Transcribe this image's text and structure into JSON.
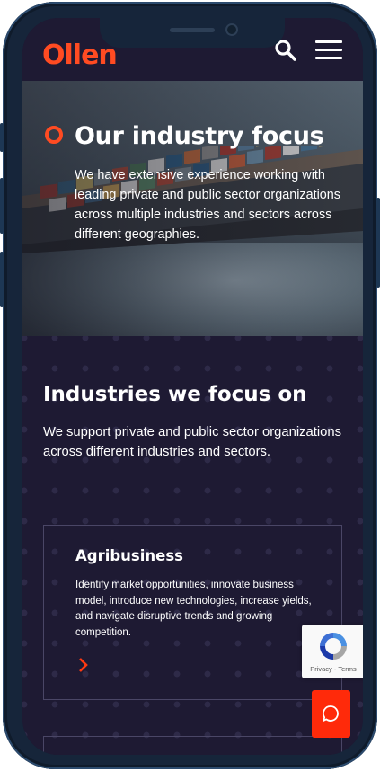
{
  "header": {
    "logo_text": "Ollen",
    "search_icon": "search-icon",
    "menu_icon": "hamburger-menu-icon"
  },
  "hero": {
    "title": "Our industry focus",
    "description": "We have extensive experience working with leading private and public sector organizations across multiple industries and sectors across different geographies."
  },
  "industries": {
    "title": "Industries we focus on",
    "description": "We support private and public sector organizations across different industries and sectors.",
    "cards": [
      {
        "title": "Agribusiness",
        "description": "Identify market opportunities, innovate business model, introduce new technologies, increase yields, and navigate disruptive trends and growing competition.",
        "arrow_icon": "chevron-right-icon"
      }
    ]
  },
  "recaptcha": {
    "links": "Privacy - Terms"
  },
  "chat": {
    "icon": "chat-bubble-icon"
  },
  "colors": {
    "brand_orange": "#ff4b22",
    "background": "#1e1a33",
    "chat_red": "#ff2a0a"
  }
}
